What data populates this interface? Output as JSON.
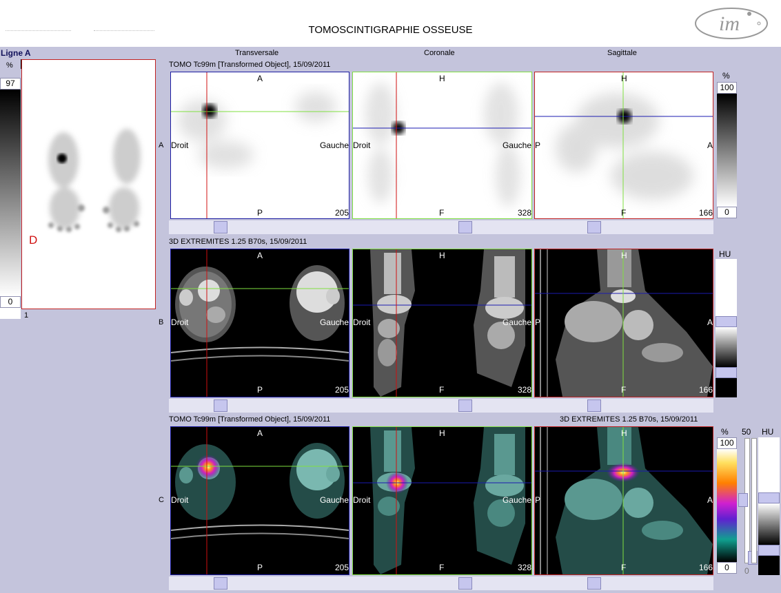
{
  "header": {
    "title": "TOMOSCINTIGRAPHIE OSSEUSE"
  },
  "left_panel": {
    "title": "Ligne A",
    "unit": "%",
    "scale_max": "97",
    "scale_min": "0",
    "frame_index": "1",
    "side_label": "D",
    "small_label": "1"
  },
  "columns": {
    "transverse": "Transversale",
    "coronal": "Coronale",
    "sagittal": "Sagittale"
  },
  "rows": {
    "a": {
      "label": "A",
      "series": "TOMO Tc99m [Transformed Object], 15/09/2011"
    },
    "b": {
      "label": "B",
      "series": "3D EXTREMITES  1.25  B70s, 15/09/2011"
    },
    "c": {
      "label": "C",
      "series_left": "TOMO Tc99m [Transformed Object], 15/09/2011",
      "series_right": "3D EXTREMITES  1.25  B70s, 15/09/2011"
    }
  },
  "orient": {
    "anterior": "A",
    "posterior": "P",
    "head": "H",
    "foot": "F",
    "right": "Droit",
    "left": "Gauche"
  },
  "slices": {
    "transverse": "205",
    "coronal": "328",
    "sagittal": "166"
  },
  "scales": {
    "row_a": {
      "unit": "%",
      "max": "100",
      "min": "0"
    },
    "row_b": {
      "unit": "HU"
    },
    "row_c": {
      "unit": "%",
      "max": "100",
      "min": "0",
      "mid_max": "50",
      "mid_min": "0",
      "unit2": "HU"
    }
  },
  "colors": {
    "background": "#c4c4dc",
    "frame_transverse": "#1a1aa0",
    "frame_coronal": "#80e040",
    "frame_sagittal": "#c02020",
    "crosshair_red": "#d01010",
    "crosshair_green": "#80e040",
    "crosshair_blue": "#1a1ab0",
    "left_label_red": "#d01010"
  },
  "icons": {
    "logo": "im-logo"
  }
}
